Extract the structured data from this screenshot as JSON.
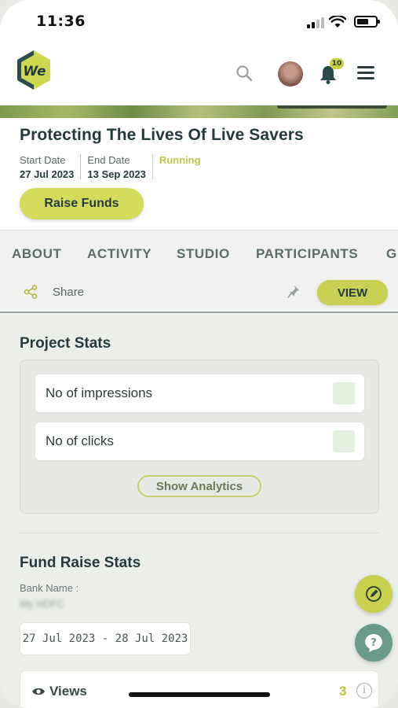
{
  "status_bar": {
    "time": "11:36"
  },
  "header": {
    "logo_text": "We",
    "notification_count": "10"
  },
  "project": {
    "title": "Protecting The Lives Of Live Savers",
    "start_label": "Start Date",
    "start_value": "27 Jul 2023",
    "end_label": "End Date",
    "end_value": "13 Sep 2023",
    "status": "Running",
    "raise_button": "Raise Funds"
  },
  "tabs": [
    {
      "label": "ABOUT"
    },
    {
      "label": "ACTIVITY"
    },
    {
      "label": "STUDIO"
    },
    {
      "label": "PARTICIPANTS"
    },
    {
      "label": "G"
    }
  ],
  "actions": {
    "share_label": "Share",
    "view_button": "VIEW"
  },
  "project_stats": {
    "title": "Project Stats",
    "rows": [
      {
        "label": "No of impressions"
      },
      {
        "label": "No of clicks"
      }
    ],
    "analytics_button": "Show Analytics"
  },
  "fund_raise": {
    "title": "Fund Raise Stats",
    "bank_label": "Bank Name :",
    "bank_value": "My HDFC",
    "date_range": "27 Jul 2023 - 28 Jul 2023",
    "views_label": "Views",
    "views_value": "3",
    "info_glyph": "i"
  },
  "colors": {
    "accent": "#d4da5b",
    "title_text": "#243a3c",
    "running": "#c2c94a",
    "help_fab": "#6a9a8a"
  },
  "icons": [
    "search-icon",
    "bell-icon",
    "menu-icon",
    "share-icon",
    "pin-icon",
    "eye-icon",
    "info-icon",
    "edit-icon",
    "help-icon"
  ]
}
